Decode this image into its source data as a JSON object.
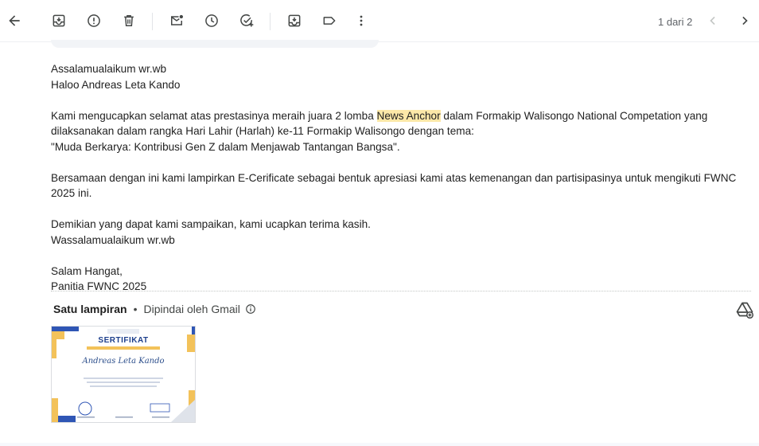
{
  "toolbar": {
    "back": "back-arrow-icon",
    "archive": "archive-icon",
    "report": "report-spam-icon",
    "delete": "delete-icon",
    "mark_unread": "mark-unread-icon",
    "snooze": "snooze-icon",
    "add_task": "add-task-icon",
    "move_to": "move-to-icon",
    "label": "label-icon",
    "more": "more-vert-icon",
    "pager_text": "1 dari 2",
    "prev": "chevron-left-icon",
    "next": "chevron-right-icon"
  },
  "email": {
    "greeting1": "Assalamualaikum wr.wb",
    "greeting2": "Haloo Andreas Leta Kando",
    "para1_before": "Kami mengucapkan selamat atas prestasinya meraih juara 2 lomba ",
    "para1_highlight": "News Anchor",
    "para1_after": " dalam Formakip Walisongo National Competation yang dilaksanakan dalam rangka Hari Lahir (Harlah) ke-11 Formakip Walisongo dengan tema:",
    "theme": "\"Muda Berkarya: Kontribusi Gen Z dalam Menjawab Tantangan Bangsa\".",
    "para2": "Bersamaan dengan ini kami lampirkan E-Cerificate sebagai bentuk apresiasi kami atas kemenangan dan partisipasinya untuk mengikuti FWNC 2025 ini.",
    "closing1": "Demikian yang dapat kami sampaikan, kami ucapkan terima kasih.",
    "closing2": "Wassalamualaikum wr.wb",
    "sign1": "Salam Hangat,",
    "sign2": "Panitia FWNC 2025"
  },
  "attachments": {
    "title": "Satu lampiran",
    "separator": "•",
    "scanned": "Dipindai oleh Gmail",
    "info_icon": "info-icon",
    "drive_icon": "add-to-drive-icon",
    "thumbnail": {
      "heading": "SERTIFIKAT",
      "name": "Andreas Leta Kando"
    }
  },
  "colors": {
    "highlight": "#fce8a8",
    "cert_blue": "#1d3f8c",
    "cert_yellow": "#f3c25a"
  }
}
